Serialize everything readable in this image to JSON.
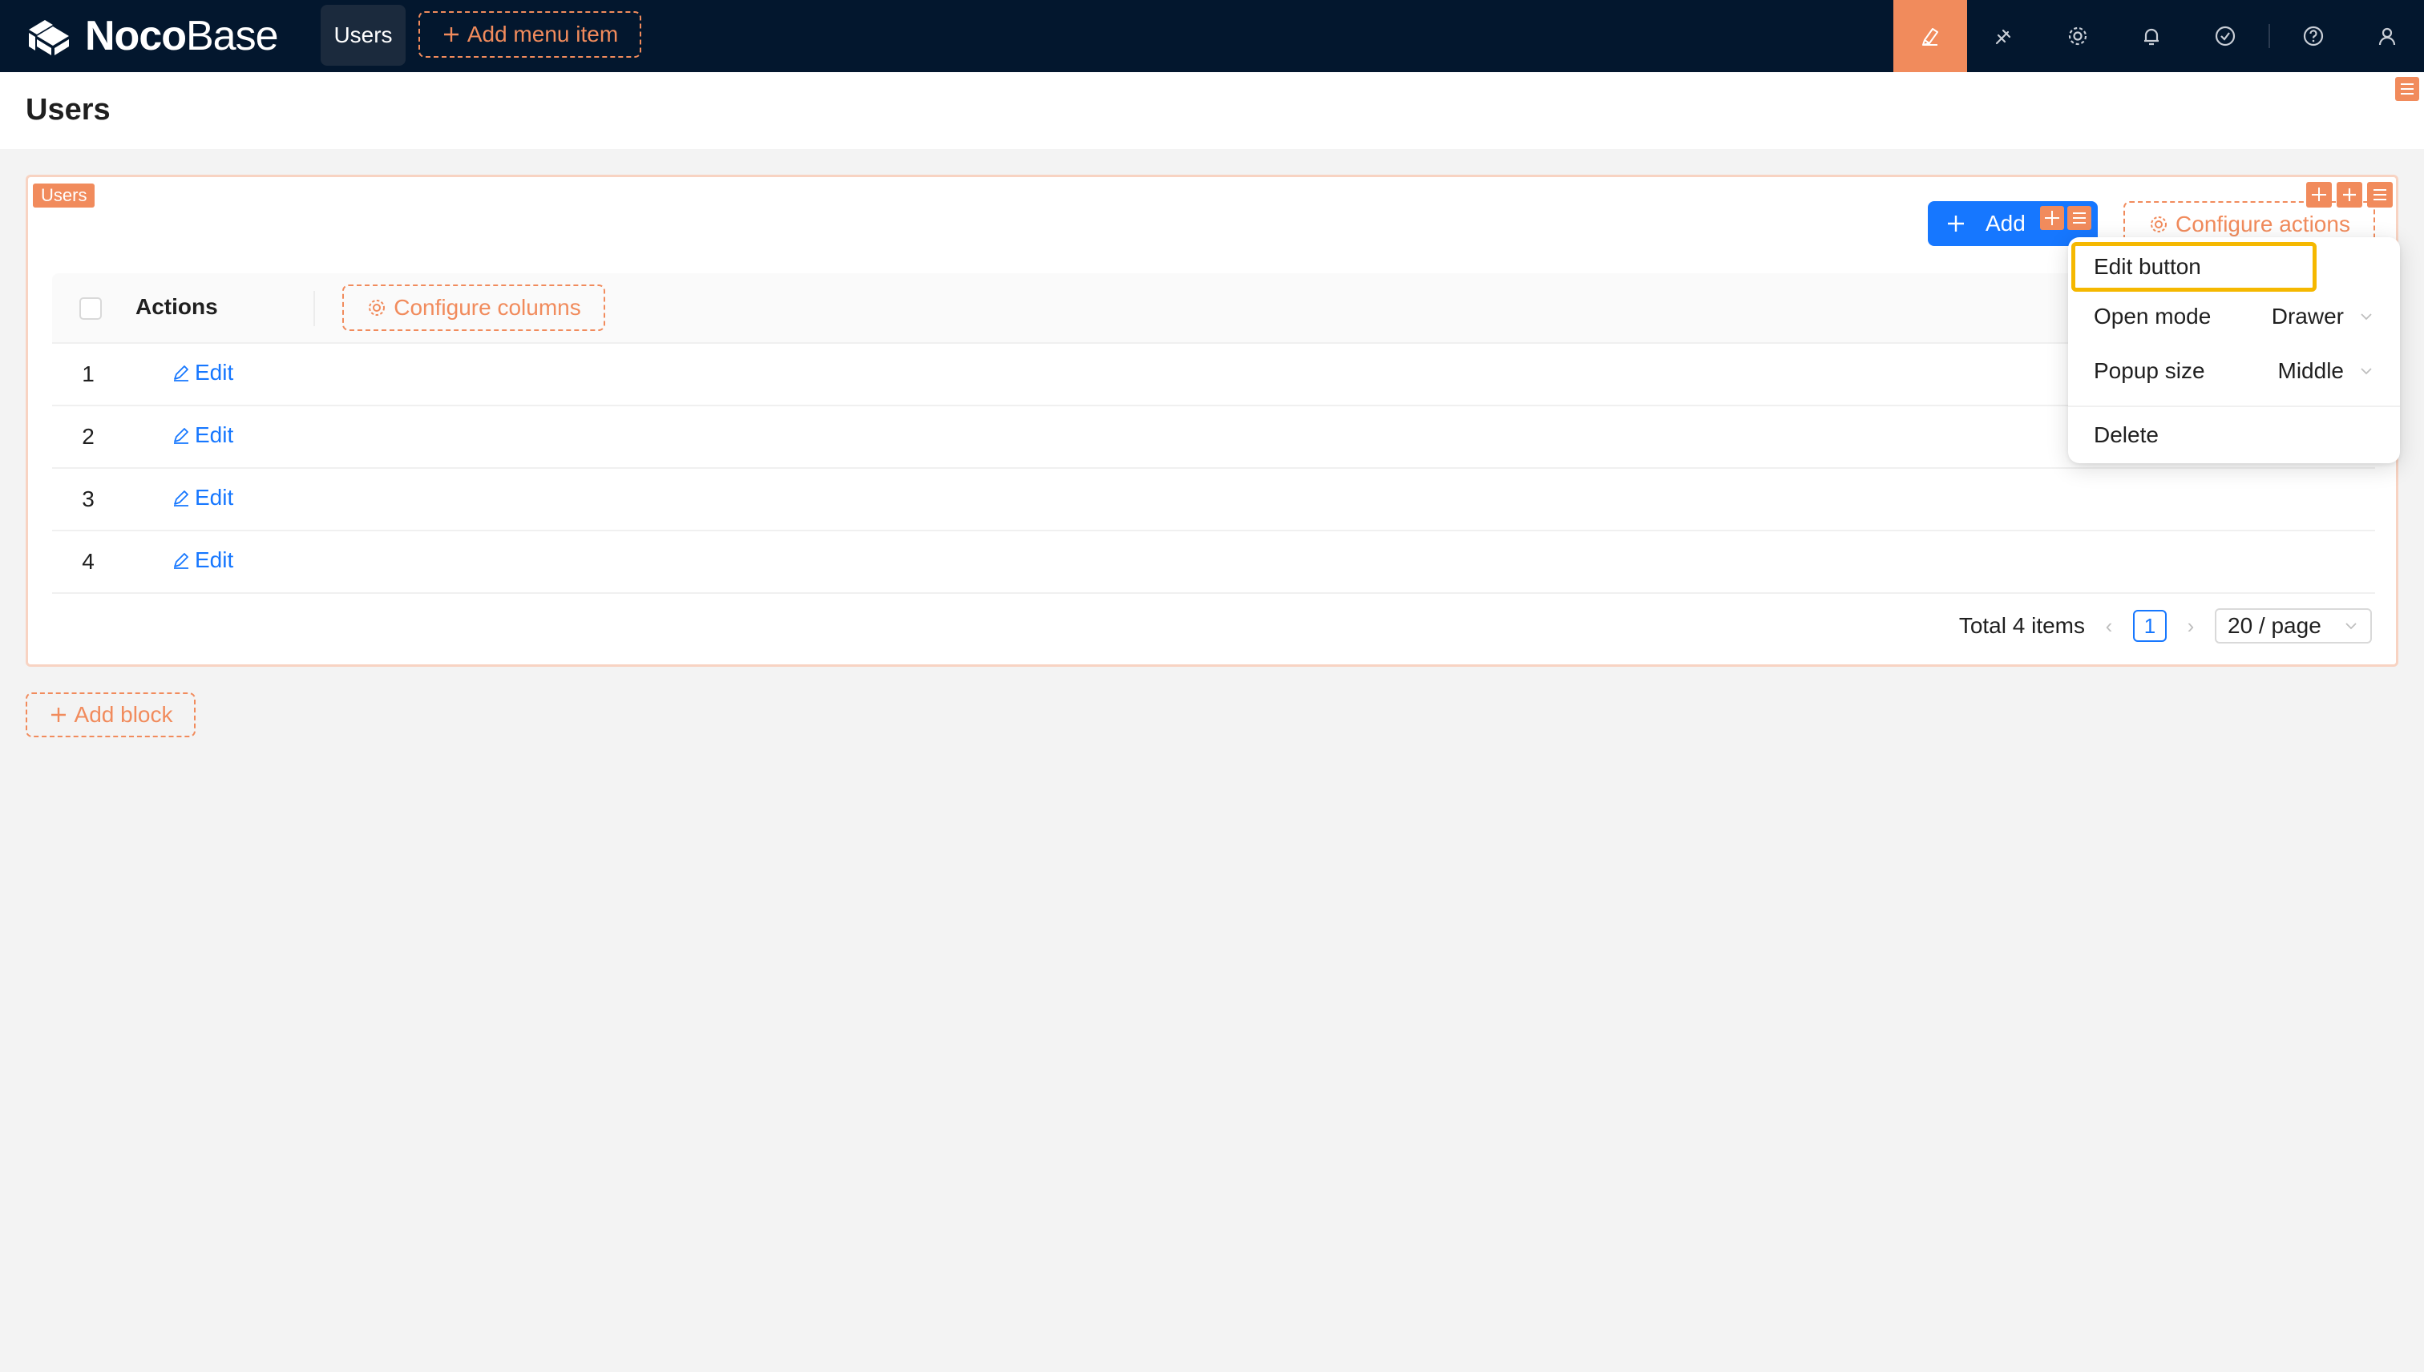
{
  "app": {
    "logo_bold": "Noco",
    "logo_light": "Base",
    "nav_active": "Users",
    "add_menu_label": "Add menu item",
    "accent": "#f18b5c",
    "topbar_bg": "#03172e",
    "primary": "#1677ff"
  },
  "topbar_icons": [
    "ui-editor-icon",
    "plugin-icon",
    "settings-icon",
    "bell-icon",
    "check-circle-icon",
    "help-icon",
    "user-icon"
  ],
  "page": {
    "title": "Users"
  },
  "block": {
    "tag": "Users",
    "add_new_label": "Add",
    "configure_actions_label": "Configure actions",
    "configure_columns_label": "Configure columns",
    "columns": [
      "Actions"
    ],
    "rows": [
      {
        "index": "1",
        "action": "Edit"
      },
      {
        "index": "2",
        "action": "Edit"
      },
      {
        "index": "3",
        "action": "Edit"
      },
      {
        "index": "4",
        "action": "Edit"
      }
    ],
    "pagination": {
      "total": "Total 4 items",
      "current_page": "1",
      "page_size": "20 / page"
    }
  },
  "add_block_label": "Add block",
  "menu": {
    "title": "Edit button",
    "open_mode_label": "Open mode",
    "open_mode_value": "Drawer",
    "popup_size_label": "Popup size",
    "popup_size_value": "Middle",
    "delete_label": "Delete"
  }
}
